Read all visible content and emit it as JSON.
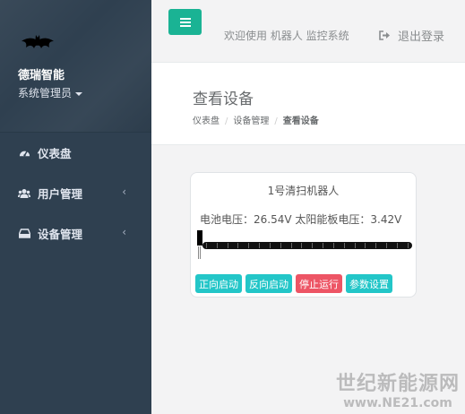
{
  "sidebar": {
    "company": "德瑞智能",
    "role": "系统管理员",
    "items": [
      {
        "label": "仪表盘",
        "icon": "dashboard-icon",
        "has_arrow": false
      },
      {
        "label": "用户管理",
        "icon": "users-icon",
        "has_arrow": true
      },
      {
        "label": "设备管理",
        "icon": "hdd-icon",
        "has_arrow": true
      }
    ]
  },
  "topbar": {
    "welcome": "欢迎使用 机器人 监控系统",
    "logout": "退出登录"
  },
  "page": {
    "title": "查看设备",
    "breadcrumb": [
      "仪表盘",
      "设备管理",
      "查看设备"
    ]
  },
  "device": {
    "name": "1号清扫机器人",
    "stats": "电池电压：26.54V 太阳能板电压：3.42V",
    "buttons": {
      "forward": "正向启动",
      "reverse": "反向启动",
      "stop": "停止运行",
      "settings": "参数设置"
    }
  },
  "watermark": {
    "site_name": "世纪新能源网",
    "url": "www.NE21.com"
  },
  "colors": {
    "sidebar": "#2f4050",
    "primary": "#1ab394",
    "info": "#23c6c8",
    "danger": "#ed5565"
  }
}
